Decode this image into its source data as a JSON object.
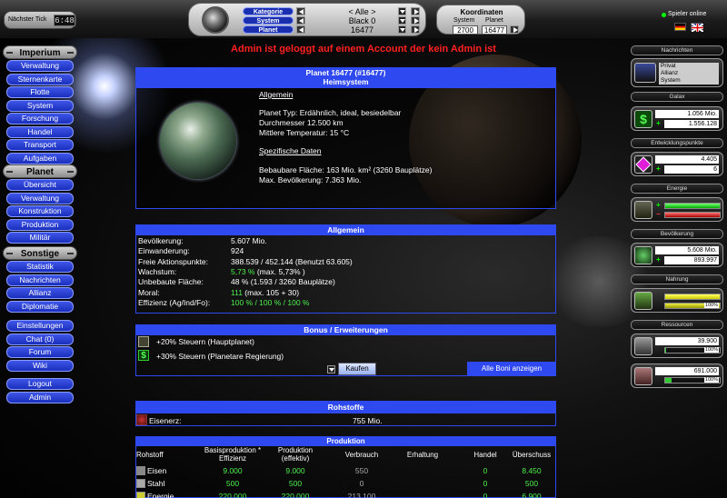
{
  "topbar": {
    "tick_label": "Nächster Tick",
    "tick_value": "6:48",
    "selectors": {
      "kategorie_label": "Kategorie",
      "system_label": "System",
      "planet_label": "Planet",
      "kategorie_value": "< Alle >",
      "system_value": "Black 0",
      "planet_value": "16477"
    },
    "coords": {
      "title": "Koordinaten",
      "system_label": "System",
      "planet_label": "Planet",
      "system_value": "2700",
      "planet_value": "16477"
    },
    "online_label": "Spieler online"
  },
  "admin_message": "Admin ist geloggt auf einem Account der kein Admin ist",
  "menu": {
    "imperium": {
      "title": "Imperium",
      "items": [
        "Verwaltung",
        "Sternenkarte",
        "Flotte",
        "System",
        "Forschung",
        "Handel",
        "Transport",
        "Aufgaben"
      ]
    },
    "planet": {
      "title": "Planet",
      "items": [
        "Übersicht",
        "Verwaltung",
        "Konstruktion",
        "Produktion",
        "Militär"
      ]
    },
    "sonstige": {
      "title": "Sonstige",
      "items": [
        "Statistik",
        "Nachrichten",
        "Allianz",
        "Diplomatie"
      ]
    },
    "misc": [
      "Einstellungen",
      "Chat (0)",
      "Forum",
      "Wiki"
    ],
    "account": [
      "Logout",
      "Admin"
    ]
  },
  "planet_box": {
    "title": "Planet 16477 (#16477)",
    "subtitle": "Heimsystem",
    "allgemein_heading": "Allgemein",
    "typ": "Planet Typ: Erdähnlich, ideal, besiedelbar",
    "durchmesser": "Durchmesser 12.500 km",
    "temperatur": "Mittlere Temperatur: 15 °C",
    "spezifisch_heading": "Spezifische Daten",
    "flaeche": "Bebaubare Fläche: 163 Mio. km² (3260 Bauplätze)",
    "bevoelkerung": "Max. Bevölkerung: 7.363 Mio."
  },
  "allgemein": {
    "title": "Allgemein",
    "rows": [
      {
        "label": "Bevölkerung:",
        "value": "5.607 Mio."
      },
      {
        "label": "Einwanderung:",
        "value": "924"
      },
      {
        "label": "Freie Aktionspunkte:",
        "value": "388.539 / 452.144 (Benutzt 63.605)"
      },
      {
        "label": "Wachstum:",
        "value_green": "5,73 %",
        "value_rest": " (max. 5,73% )"
      },
      {
        "label": "Unbebaute Fläche:",
        "value": "48 % (1.593 / 3260 Bauplätze)"
      },
      {
        "label": "Moral:",
        "value_green": "111",
        "value_rest": " (max. 105 + 30)"
      },
      {
        "label": "Effizienz (Ag/Ind/Fo):",
        "value_green": "100 % / 100 % / 100 %",
        "value_rest": ""
      }
    ]
  },
  "bonus": {
    "title": "Bonus / Erweiterungen",
    "items": [
      "+20% Steuern (Hauptplanet)",
      "+30% Steuern (Planetare Regierung)"
    ],
    "buy_label": "Kaufen",
    "all_label": "Alle Boni anzeigen"
  },
  "rohstoffe": {
    "title": "Rohstoffe",
    "name": "Eisenerz:",
    "value": "755 Mio."
  },
  "produktion": {
    "title": "Produktion",
    "headers": [
      "Rohstoff",
      "Basisproduktion * Effizienz",
      "Produktion (effektiv)",
      "Verbrauch",
      "Erhaltung",
      "Handel",
      "Überschuss"
    ],
    "rows": [
      {
        "name": "Eisen",
        "basis": "9.000",
        "prod": "9.000",
        "verbrauch": "550",
        "erhaltung": "",
        "handel": "0",
        "ueberschuss": "8.450"
      },
      {
        "name": "Stahl",
        "basis": "500",
        "prod": "500",
        "verbrauch": "0",
        "erhaltung": "",
        "handel": "0",
        "ueberschuss": "500"
      },
      {
        "name": "Energie",
        "basis": "220.000",
        "prod": "220.000",
        "verbrauch": "213.100",
        "erhaltung": "",
        "handel": "0",
        "ueberschuss": "6.900"
      }
    ]
  },
  "right": {
    "nachrichten": "Nachrichten",
    "msg_tabs": [
      "Privat",
      "Allianz",
      "System"
    ],
    "galax": "Galax",
    "galax_values": [
      "1.056 Mio.",
      "1.556.128"
    ],
    "entwicklung": "Entwicklungspunkte",
    "entwicklung_values": [
      "4.405",
      "6"
    ],
    "energie": "Energie",
    "bevoelkerung": "Bevölkerung",
    "bevoelkerung_values": [
      "5.608 Mio.",
      "893.997"
    ],
    "nahrung": "Nahrung",
    "nahrung_pct": "100%",
    "ressourcen": "Ressourcen",
    "res1_value": "39.900",
    "res1_pct": "100%",
    "res2_value": "691.000",
    "res2_pct": "100%"
  },
  "colors": {
    "accent": "#2f49f0",
    "menu_blue": "#1a2fbc",
    "alert": "#ff2020",
    "green": "#4ef04e"
  }
}
